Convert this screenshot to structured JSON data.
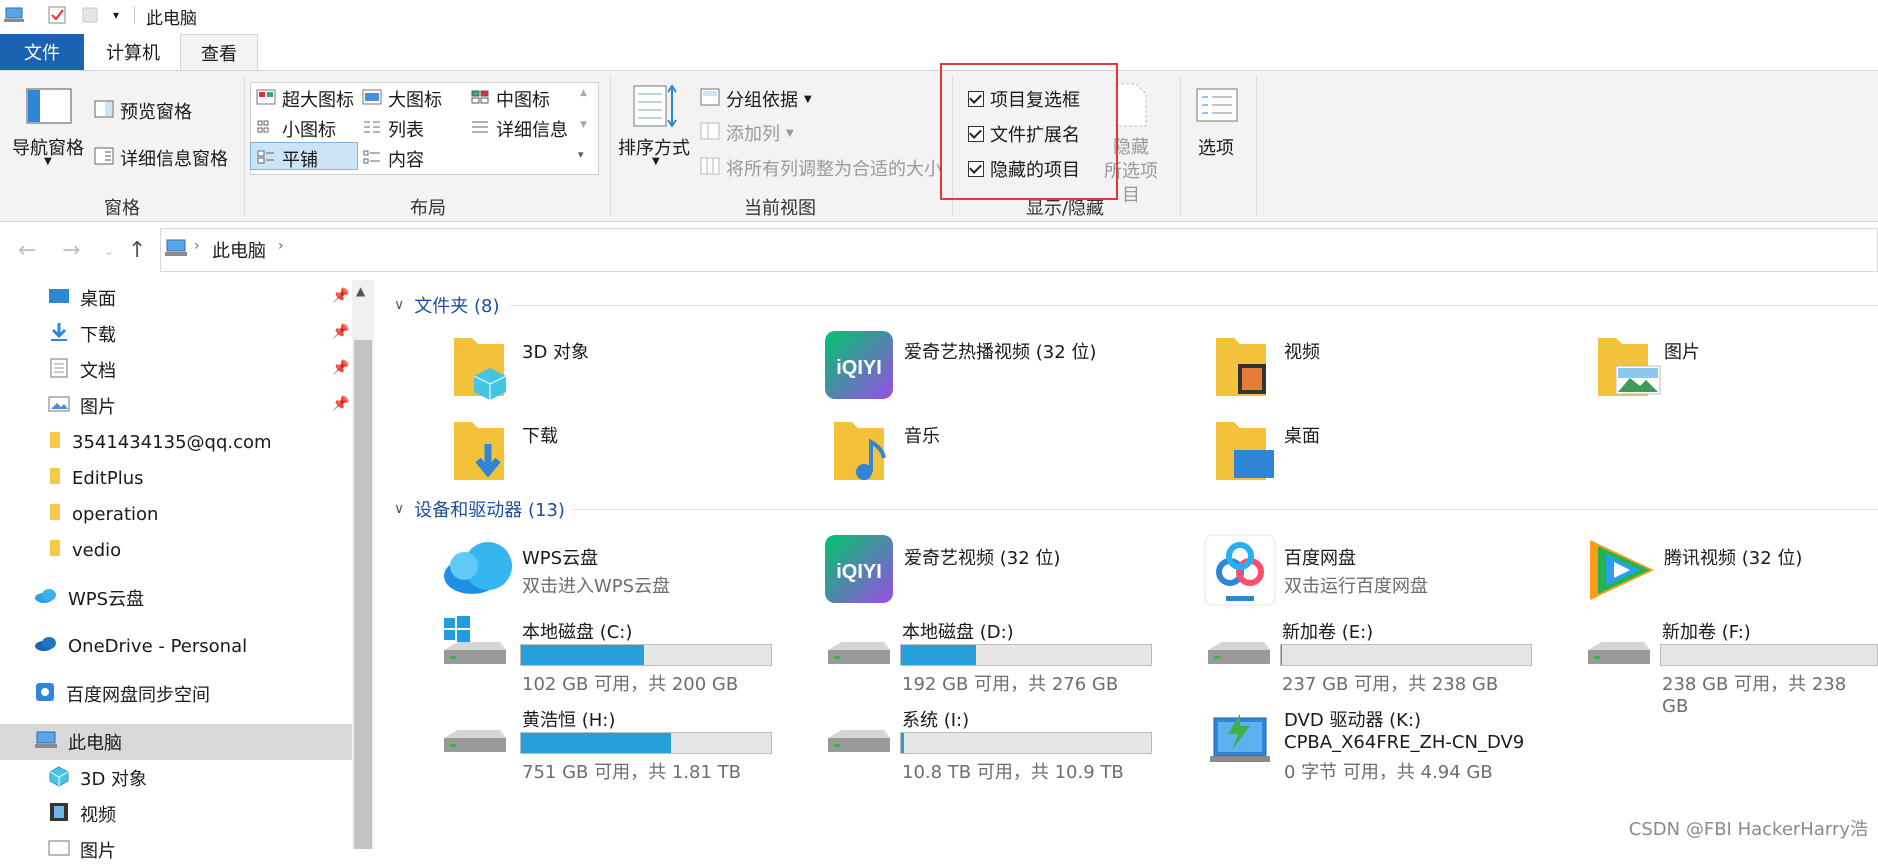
{
  "window": {
    "title": "此电脑"
  },
  "tabs": [
    {
      "label": "文件"
    },
    {
      "label": "计算机"
    },
    {
      "label": "查看"
    }
  ],
  "ribbon": {
    "pane": {
      "nav_pane": "导航窗格",
      "preview_pane": "预览窗格",
      "details_pane": "详细信息窗格",
      "group": "窗格"
    },
    "layout": {
      "items": [
        "超大图标",
        "大图标",
        "中图标",
        "小图标",
        "列表",
        "详细信息",
        "平铺",
        "内容"
      ],
      "selected": "平铺",
      "group": "布局"
    },
    "current_view": {
      "sort_by": "排序方式",
      "group_by": "分组依据",
      "add_column": "添加列",
      "fit_columns": "将所有列调整为合适的大小",
      "group": "当前视图"
    },
    "show_hide": {
      "item_checkboxes": "项目复选框",
      "file_extensions": "文件扩展名",
      "hidden_items": "隐藏的项目",
      "hide_selected_line1": "隐藏",
      "hide_selected_line2": "所选项目",
      "group": "显示/隐藏"
    },
    "options": "选项"
  },
  "address": {
    "path": "此电脑"
  },
  "nav_pane": {
    "items": [
      "桌面",
      "下载",
      "文档",
      "图片",
      "3541434135@qq.com",
      "EditPlus",
      "operation",
      "vedio",
      "WPS云盘",
      "OneDrive - Personal",
      "百度网盘同步空间",
      "此电脑",
      "3D 对象",
      "视频",
      "图片"
    ]
  },
  "folders": {
    "header": "文件夹 (8)",
    "items": [
      "3D 对象",
      "爱奇艺热播视频 (32 位)",
      "视频",
      "图片",
      "下载",
      "音乐",
      "桌面"
    ]
  },
  "devices": {
    "header": "设备和驱动器 (13)",
    "apps": [
      {
        "name": "WPS云盘",
        "sub": "双击进入WPS云盘"
      },
      {
        "name": "爱奇艺视频 (32 位)",
        "sub": ""
      },
      {
        "name": "百度网盘",
        "sub": "双击运行百度网盘"
      },
      {
        "name": "腾讯视频 (32 位)",
        "sub": ""
      }
    ],
    "drives": [
      {
        "name": "本地磁盘 (C:)",
        "info": "102 GB 可用，共 200 GB",
        "used": 0.49
      },
      {
        "name": "本地磁盘 (D:)",
        "info": "192 GB 可用，共 276 GB",
        "used": 0.3
      },
      {
        "name": "新加卷 (E:)",
        "info": "237 GB 可用，共 238 GB",
        "used": 0.004
      },
      {
        "name": "新加卷 (F:)",
        "info": "238 GB 可用，共 238 GB",
        "used": 0.0
      },
      {
        "name": "黄浩恒 (H:)",
        "info": "751 GB 可用，共 1.81 TB",
        "used": 0.6
      },
      {
        "name": "系统 (I:)",
        "info": "10.8 TB 可用，共 10.9 TB",
        "used": 0.01
      }
    ],
    "dvd": {
      "name": "DVD 驱动器 (K:)",
      "label": "CPBA_X64FRE_ZH-CN_DV9",
      "info": "0 字节 可用，共 4.94 GB"
    }
  },
  "watermark": "CSDN @FBI HackerHarry浩",
  "colors": {
    "accent": "#1a63b0",
    "bar_fill": "#26a0da",
    "highlight_box": "#e53935",
    "section_text": "#1c4e9c"
  }
}
